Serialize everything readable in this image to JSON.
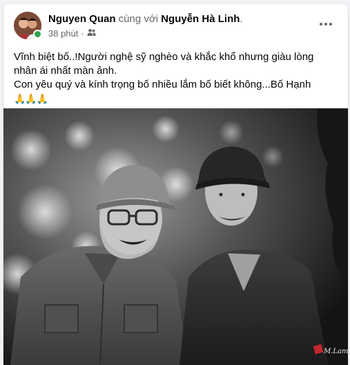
{
  "post": {
    "author": "Nguyen Quan",
    "with_text": " cùng với ",
    "tagged": "Nguyễn Hà Linh",
    "period": ".",
    "time": "38 phút",
    "separator": "·",
    "audience_icon": "friends-icon",
    "text_lines": [
      "Vĩnh biệt bố..!Người nghệ sỹ nghèo và khắc khổ nhưng giàu lòng",
      "nhân ái nhất màn ảnh.",
      "Con yêu quý và kính trọng bố nhiều lắm bố biết không...Bố Hạnh"
    ],
    "emoji": "🙏🙏🙏"
  },
  "photo": {
    "signature": "M.Lam"
  },
  "colors": {
    "online": "#31a24c",
    "background": "#f0f2f5"
  }
}
